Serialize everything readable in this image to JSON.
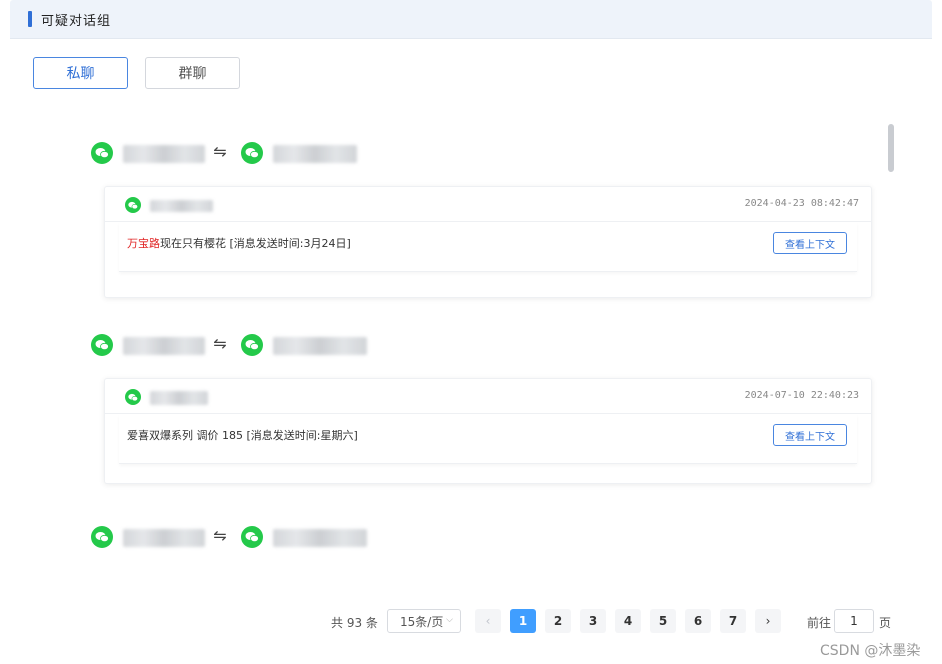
{
  "panel": {
    "title": "可疑对话组"
  },
  "tabs": [
    {
      "label": "私聊",
      "active": true
    },
    {
      "label": "群聊",
      "active": false
    }
  ],
  "pair_arrow": "⇋",
  "messages": [
    {
      "time": "2024-04-23 08:42:47",
      "keyword": "万宝路",
      "text": "现在只有樱花 [消息发送时间:3月24日]",
      "action": "查看上下文"
    },
    {
      "time": "2024-07-10 22:40:23",
      "keyword": "",
      "text": "爱喜双爆系列 调价 185 [消息发送时间:星期六]",
      "action": "查看上下文"
    }
  ],
  "pagination": {
    "total": "共 93 条",
    "page_size": "15条/页",
    "prev": "‹",
    "next": "›",
    "pages": [
      "1",
      "2",
      "3",
      "4",
      "5",
      "6",
      "7"
    ],
    "current": "1",
    "goto_label": "前往",
    "goto_value": "1",
    "goto_unit": "页"
  },
  "watermark": "CSDN @沐墨染",
  "colors": {
    "accent": "#2f6fd6",
    "wechat": "#24c94a",
    "keyword": "#e02424",
    "page_active": "#409eff"
  },
  "icons": {
    "contact": "wechat-icon"
  }
}
